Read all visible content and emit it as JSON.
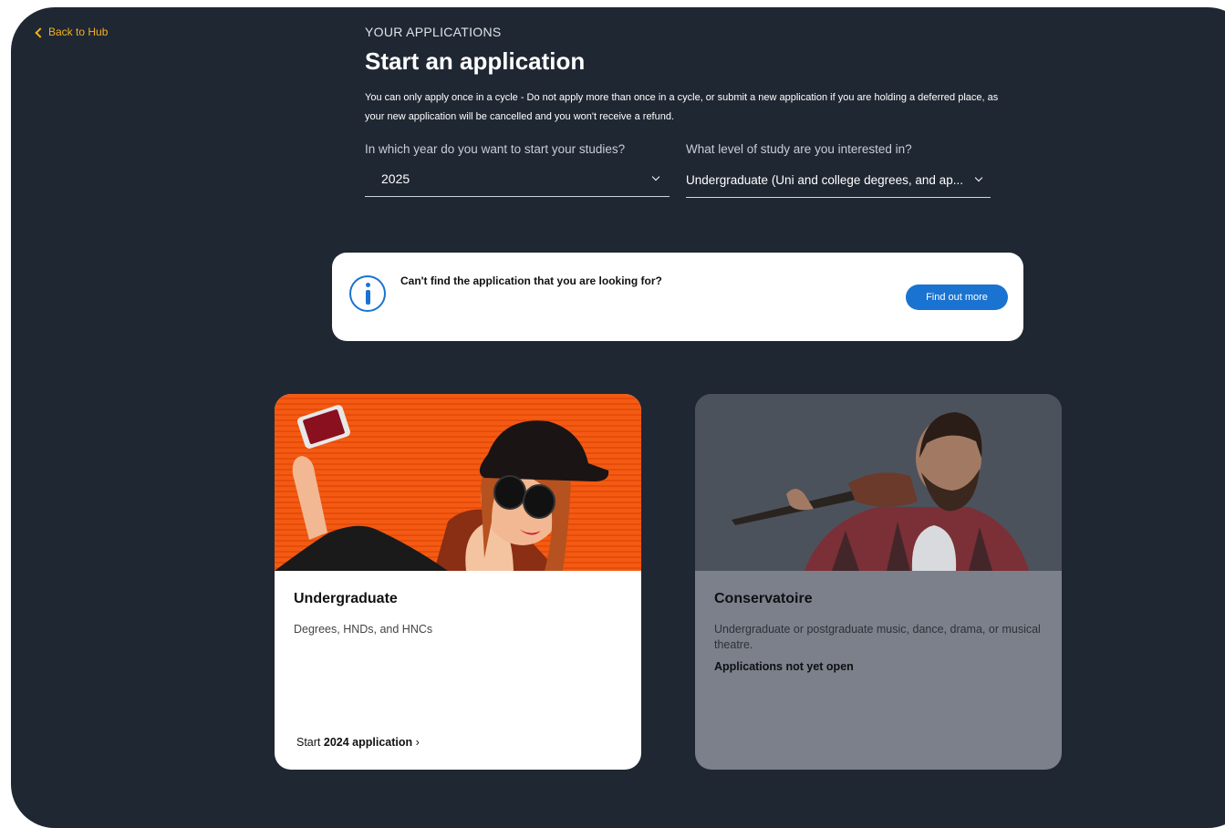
{
  "nav": {
    "back_label": "Back to Hub"
  },
  "header": {
    "eyebrow": "YOUR APPLICATIONS",
    "title": "Start an application",
    "intro": "You can only apply once in a cycle - Do not apply more than once in a cycle, or submit a new application if you are holding a deferred place, as your new application will be cancelled and you won't receive a refund."
  },
  "filters": {
    "year": {
      "label": "In which year do you want to start your studies?",
      "value": "2025"
    },
    "level": {
      "label": "What level of study are you interested in?",
      "value": "Undergraduate (Uni and college degrees, and ap..."
    }
  },
  "info_banner": {
    "text": "Can't find the application that you are looking for?",
    "button_label": "Find out more"
  },
  "cards": [
    {
      "title": "Undergraduate",
      "description": "Degrees, HNDs, and HNCs",
      "link_prefix": "Start ",
      "link_bold": "2024 application",
      "link_suffix": " ›"
    },
    {
      "title": "Conservatoire",
      "description": "Undergraduate or postgraduate music, dance, drama, or musical theatre.",
      "status": "Applications not yet open"
    }
  ],
  "colors": {
    "background": "#1f2732",
    "accent": "#f5b01e",
    "primary_button": "#1a73d0"
  }
}
